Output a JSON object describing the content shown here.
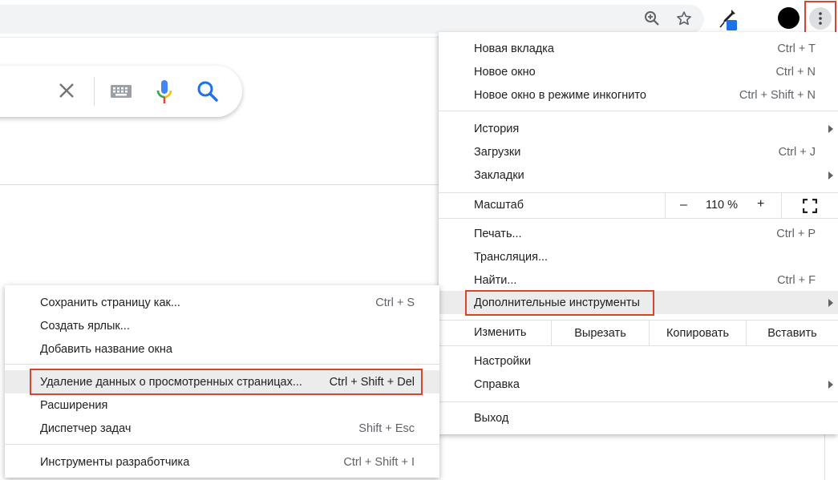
{
  "toolbar": {
    "icons": [
      "zoom-in-icon",
      "star-icon",
      "eyedropper-extension-icon",
      "avatar",
      "more-vert-icon"
    ]
  },
  "search": {
    "icons": [
      "close-icon",
      "keyboard-icon",
      "microphone-icon",
      "search-icon"
    ]
  },
  "menu": {
    "new_tab": {
      "label": "Новая вкладка",
      "shortcut": "Ctrl + T"
    },
    "new_window": {
      "label": "Новое окно",
      "shortcut": "Ctrl + N"
    },
    "incognito": {
      "label": "Новое окно в режиме инкогнито",
      "shortcut": "Ctrl + Shift + N"
    },
    "history": {
      "label": "История"
    },
    "downloads": {
      "label": "Загрузки",
      "shortcut": "Ctrl + J"
    },
    "bookmarks": {
      "label": "Закладки"
    },
    "zoom": {
      "label": "Масштаб",
      "minus": "–",
      "value": "110 %",
      "plus": "+"
    },
    "print": {
      "label": "Печать...",
      "shortcut": "Ctrl + P"
    },
    "cast": {
      "label": "Трансляция..."
    },
    "find": {
      "label": "Найти...",
      "shortcut": "Ctrl + F"
    },
    "more_tools": {
      "label": "Дополнительные инструменты"
    },
    "edit": {
      "label": "Изменить",
      "cut": "Вырезать",
      "copy": "Копировать",
      "paste": "Вставить"
    },
    "settings": {
      "label": "Настройки"
    },
    "help": {
      "label": "Справка"
    },
    "exit": {
      "label": "Выход"
    }
  },
  "submenu": {
    "save_page": {
      "label": "Сохранить страницу как...",
      "shortcut": "Ctrl + S"
    },
    "create_shortcut": {
      "label": "Создать ярлык..."
    },
    "name_window": {
      "label": "Добавить название окна"
    },
    "clear_data": {
      "label": "Удаление данных о просмотренных страницах...",
      "shortcut": "Ctrl + Shift + Del"
    },
    "extensions": {
      "label": "Расширения"
    },
    "task_manager": {
      "label": "Диспетчер задач",
      "shortcut": "Shift + Esc"
    },
    "devtools": {
      "label": "Инструменты разработчика",
      "shortcut": "Ctrl + Shift + I"
    }
  },
  "colors": {
    "highlight_border": "#d9452a",
    "hover_bg": "#ececec",
    "google_blue": "#1a73e8",
    "mic_red": "#ea4335",
    "mic_yellow": "#fbbc04",
    "mic_green": "#34a853"
  }
}
